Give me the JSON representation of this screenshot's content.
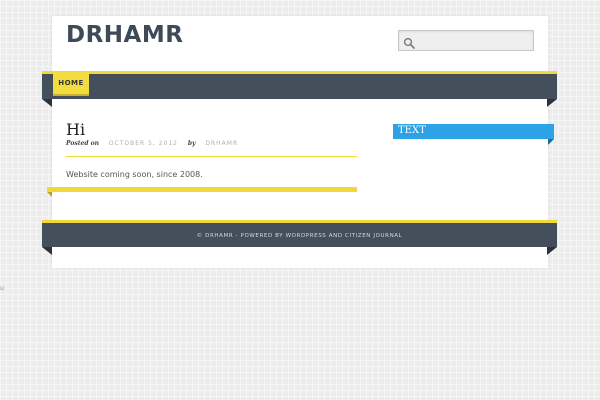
{
  "site": {
    "title": "DRHAMR"
  },
  "search": {
    "placeholder": "",
    "value": "",
    "icon": "search-icon"
  },
  "nav": {
    "items": [
      {
        "label": "HOME",
        "active": true
      }
    ]
  },
  "post": {
    "title": "Hi",
    "posted_on_label": "Posted on",
    "date": "OCTOBER 5, 2012",
    "by_label": "by",
    "author": "DRHAMR",
    "content": "Website coming soon, since 2008."
  },
  "sidebar": {
    "widget_title": "TEXT"
  },
  "footer": {
    "copyright": "© DRHAMR",
    "separator": " - POWERED BY ",
    "wordpress": "WORDPRESS",
    "and": " AND ",
    "theme": "CITIZEN JOURNAL"
  },
  "edge_mark": "u",
  "colors": {
    "accent_yellow": "#f0d83a",
    "nav_dark": "#454f5c",
    "widget_blue": "#2ea2e6",
    "title_color": "#3f4a58"
  }
}
